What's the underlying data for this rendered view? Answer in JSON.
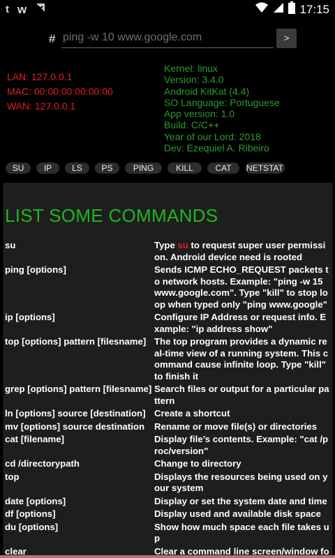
{
  "status": {
    "time": "17:15",
    "icons": [
      "tumblr-icon",
      "w-app-icon",
      "cancel-icon",
      "wifi-icon",
      "signal-icon",
      "battery-icon"
    ]
  },
  "command": {
    "prompt": "#",
    "placeholder": "ping -w 10 www.google.com",
    "run_label": ">"
  },
  "network": {
    "lan": "LAN: 127.0.0.1",
    "mac": "MAC: 00:00:00:00:00:00",
    "wan": "WAN: 127.0.0.1"
  },
  "system": [
    "Kernel: linux",
    "Version: 3.4.0",
    "Android KitKat (4.4)",
    "SO Language: Portuguese",
    "App version: 1.0",
    "Build: C/C++",
    "Year of our Lord: 2018",
    "Dev: Ezequiel A. Ribeiro"
  ],
  "chips": [
    "SU",
    "IP",
    "LS",
    "PS",
    "PING",
    "KILL",
    "CAT",
    "NETSTAT"
  ],
  "panel": {
    "title": "LIST SOME COMMANDS",
    "rows": [
      {
        "cmd": "su",
        "desc_pre": "Type ",
        "desc_hl": "su",
        "desc_post": " to request super user permission. Android device need is rooted"
      },
      {
        "cmd": "ping [options]",
        "desc": "Sends ICMP ECHO_REQUEST packets to network hosts. Example: \"ping -w 15 www.google.com\". Type \"kill\" to stop loop when typed only \"ping www.google\""
      },
      {
        "cmd": "ip [options]",
        "desc": "Configure IP Address or request info. Example: \"ip address show\""
      },
      {
        "cmd": "top [options] pattern [filesname]",
        "desc": "The top program provides a dynamic real-time view of a running system. This command cause infinite loop. Type \"kill\" to finish it"
      },
      {
        "cmd": "grep [options] pattern [filesname]",
        "desc": "Search files or output for a particular pattern"
      },
      {
        "cmd": "ln [options] source [destination]",
        "desc": "Create a shortcut"
      },
      {
        "cmd": "mv [options] source destination",
        "desc": "Rename or move file(s) or directories"
      },
      {
        "cmd": "cat [filename]",
        "desc": "Display file’s contents. Example: \"cat /proc/version\""
      },
      {
        "cmd": "cd /directorypath",
        "desc": "Change to directory"
      },
      {
        "cmd": "top",
        "desc": "Displays the resources being used on your system"
      },
      {
        "cmd": "date [options]",
        "desc": "Display or set the system date and time"
      },
      {
        "cmd": "df [options]",
        "desc": "Display used and available disk space"
      },
      {
        "cmd": "du [options]",
        "desc": "Show how much space each file takes up"
      },
      {
        "cmd": "clear",
        "desc": "Clear a command line screen/window for a fresh start"
      }
    ]
  }
}
